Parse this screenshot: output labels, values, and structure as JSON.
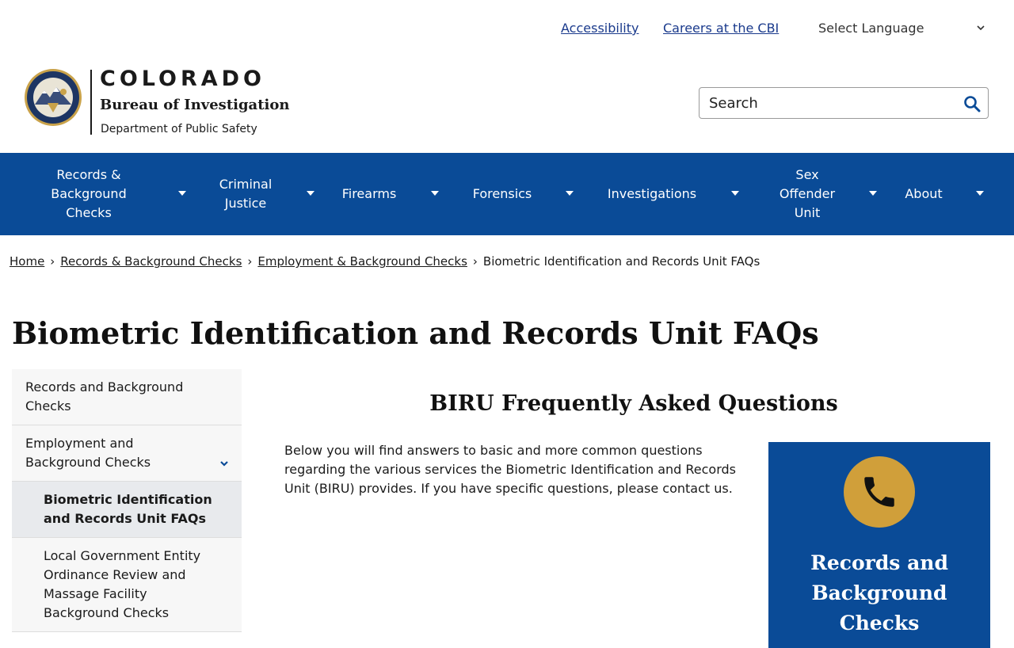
{
  "utility": {
    "accessibility": "Accessibility",
    "careers": "Careers at the CBI",
    "language": "Select Language"
  },
  "logo": {
    "state": "COLORADO",
    "agency": "Bureau of Investigation",
    "department": "Department of Public Safety"
  },
  "search": {
    "placeholder": "Search"
  },
  "nav": {
    "items": [
      {
        "label": "Records & Background Checks"
      },
      {
        "label": "Criminal Justice"
      },
      {
        "label": "Firearms"
      },
      {
        "label": "Forensics"
      },
      {
        "label": "Investigations"
      },
      {
        "label": "Sex Offender Unit"
      },
      {
        "label": "About"
      }
    ]
  },
  "breadcrumb": {
    "items": [
      "Home",
      "Records & Background Checks",
      "Employment & Background Checks",
      "Biometric Identification and Records Unit FAQs"
    ],
    "separator": "›"
  },
  "page": {
    "title": "Biometric Identification and Records Unit FAQs"
  },
  "sidenav": {
    "items": [
      {
        "label": "Records and Background Checks"
      },
      {
        "label": "Employment and Background Checks"
      },
      {
        "label": "Biometric Identification and Records Unit FAQs"
      },
      {
        "label": "Local Government Entity Ordinance Review and Massage Facility Background Checks"
      }
    ]
  },
  "main": {
    "section_title": "BIRU Frequently Asked Questions",
    "intro": "Below you will find answers to basic and more common questions regarding the various services the Biometric Identification and Records Unit (BIRU) provides. If you have specific questions, please contact us."
  },
  "card": {
    "title": "Records and Background Checks",
    "icon": "phone-icon"
  },
  "colors": {
    "brand_blue": "#0a4b97",
    "accent_gold": "#d09f3a",
    "link_blue": "#1a3a8c"
  }
}
